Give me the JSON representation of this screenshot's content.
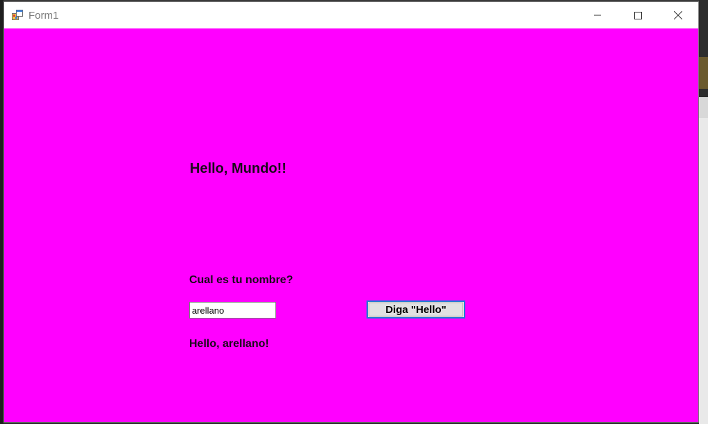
{
  "window": {
    "title": "Form1"
  },
  "form": {
    "heading": "Hello, Mundo!!",
    "question_label": "Cual es tu nombre?",
    "name_input_value": "arellano",
    "say_button_label": "Diga \"Hello\"",
    "result_label": "Hello, arellano!"
  },
  "colors": {
    "form_background": "#ff00ff",
    "titlebar_background": "#ffffff",
    "button_focus_border": "#1e7bd4"
  },
  "icons": {
    "app": "winforms-app-icon",
    "minimize": "minimize-icon",
    "maximize": "maximize-icon",
    "close": "close-icon"
  }
}
